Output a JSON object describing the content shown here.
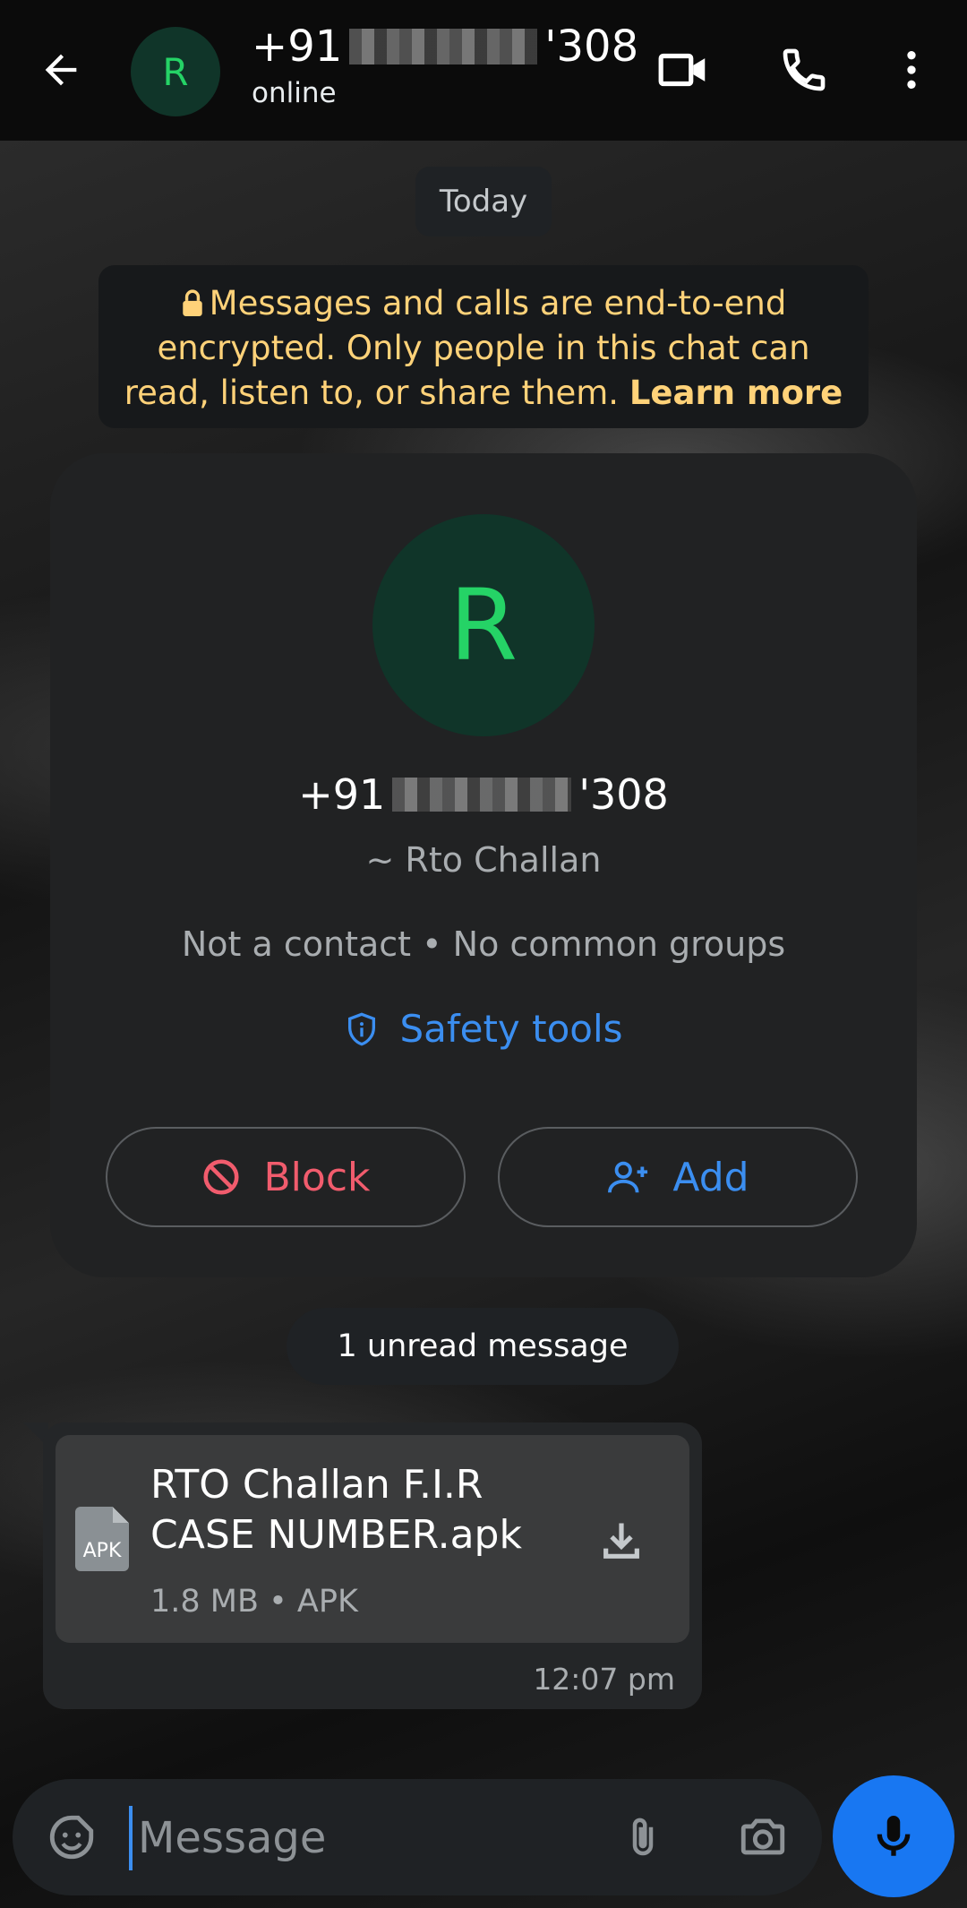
{
  "header": {
    "phone_prefix": "+91",
    "phone_suffix": "'308",
    "status": "online",
    "avatar_letter": "R",
    "icons": [
      "back-arrow-icon",
      "video-call-icon",
      "phone-icon",
      "more-vert-icon"
    ]
  },
  "chat": {
    "date_chip": "Today",
    "encryption_notice": "Messages and calls are end-to-end encrypted. Only people in this chat can read, listen to, or share them.",
    "learn_more": "Learn more",
    "contact_card": {
      "avatar_letter": "R",
      "phone_prefix": "+91",
      "phone_suffix": "'308",
      "alias": "~ Rto Challan",
      "meta": "Not a contact • No common groups",
      "safety_tools": "Safety tools",
      "block_label": "Block",
      "add_label": "Add"
    },
    "unread_chip": "1 unread message",
    "message": {
      "file_icon_label": "APK",
      "file_name": "RTO Challan F.I.R CASE NUMBER.apk",
      "file_meta": "1.8 MB • APK",
      "time": "12:07 pm"
    }
  },
  "composer": {
    "placeholder": "Message"
  },
  "colors": {
    "accent_blue": "#1877f2",
    "link_blue": "#3b8ef0",
    "block_red": "#f15c6d",
    "encryption_yellow": "#ffd279",
    "avatar_green": "#25d366"
  }
}
